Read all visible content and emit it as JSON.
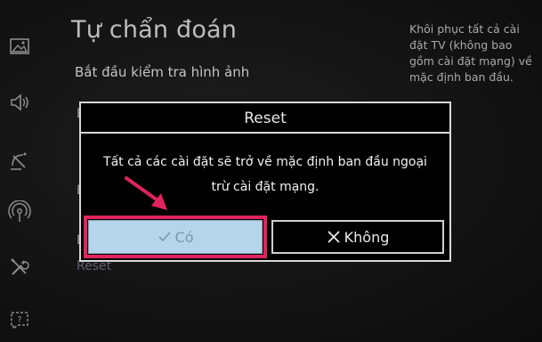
{
  "screen_title": "Tự chẩn đoán",
  "menu": {
    "first_item": "Bắt đầu kiểm tra hình ảnh",
    "partial_items": [
      "E",
      "E",
      "E"
    ],
    "reset_item": "Reset"
  },
  "help_text": "Khôi phục tất cả cài đặt TV (không bao gồm cài đặt mạng) về mặc định ban đầu.",
  "dialog": {
    "title": "Reset",
    "message": "Tất cả các cài đặt sẽ trở về mặc định ban đầu ngoại trừ cài đặt mạng.",
    "yes_label": "Có",
    "no_label": "Không"
  },
  "sidebar_icons": [
    "picture-icon",
    "sound-icon",
    "broadcast-icon",
    "network-icon",
    "support-tools-icon",
    "help-icon"
  ],
  "colors": {
    "accent_highlight": "#e0245e",
    "selected_button": "#b5d6ea"
  }
}
